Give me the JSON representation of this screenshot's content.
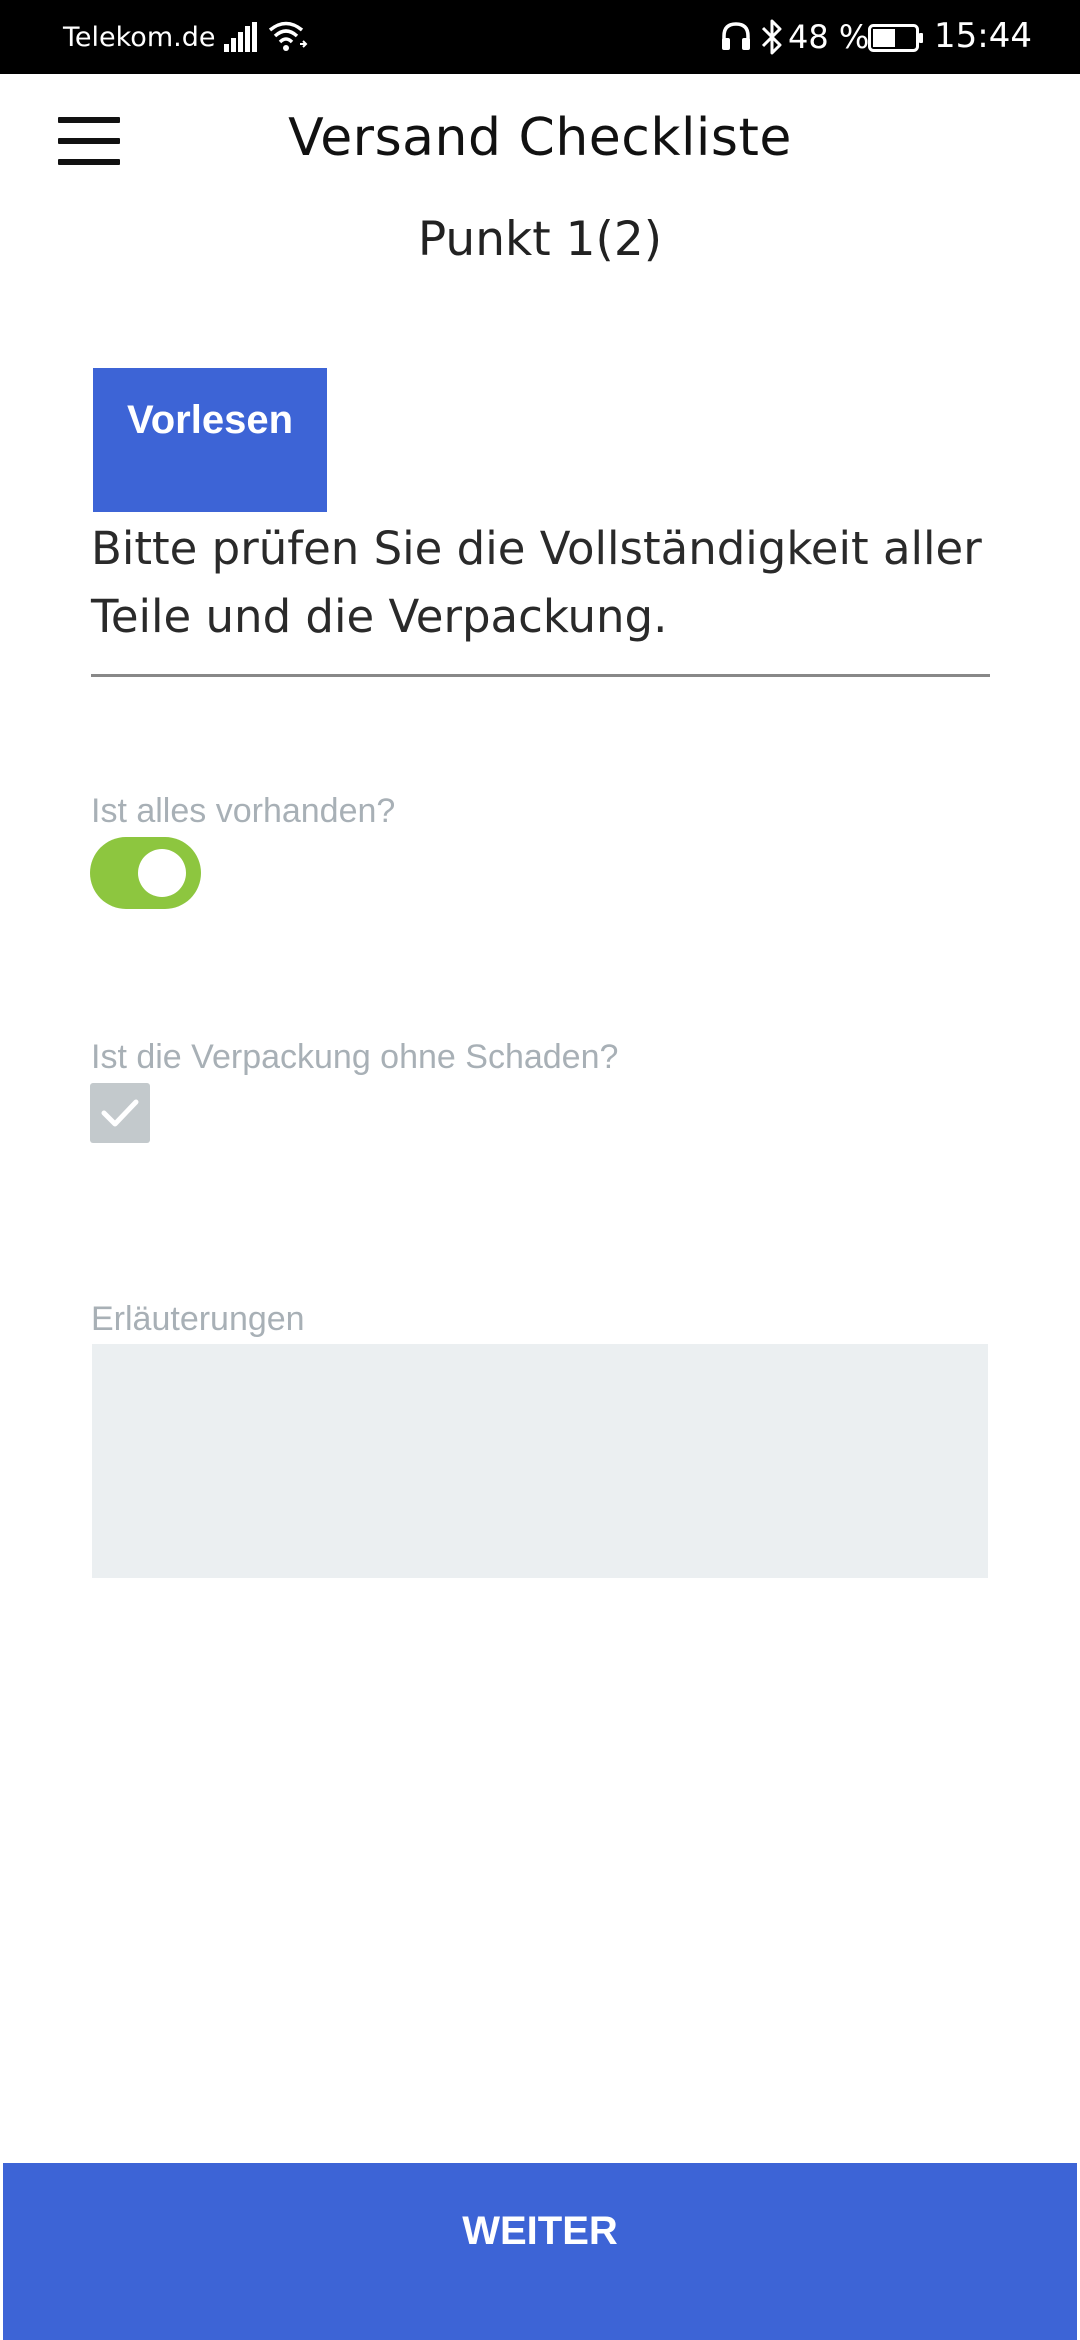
{
  "status_bar": {
    "carrier": "Telekom.de",
    "battery": "48 %",
    "time": "15:44",
    "icons": [
      "signal-icon",
      "wifi-icon",
      "headset-icon",
      "bluetooth-icon",
      "battery-icon"
    ]
  },
  "header": {
    "menu_icon": "hamburger-menu-icon",
    "title": "Versand Checkliste",
    "subtitle": "Punkt 1(2)"
  },
  "main": {
    "read_button_label": "Vorlesen",
    "instruction": "Bitte prüfen Sie die Vollständigkeit aller Teile und die Verpackung.",
    "question1": {
      "label": "Ist alles vorhanden?",
      "toggle_on": true,
      "color": "#8dc63f"
    },
    "question2": {
      "label": "Ist die Verpackung ohne Schaden?",
      "checked": true
    },
    "notes": {
      "label": "Erläuterungen",
      "value": ""
    }
  },
  "footer": {
    "next_label": "WEITER"
  },
  "colors": {
    "accent": "#3d64d6",
    "toggle": "#8dc63f",
    "label": "#a8b0b6"
  }
}
